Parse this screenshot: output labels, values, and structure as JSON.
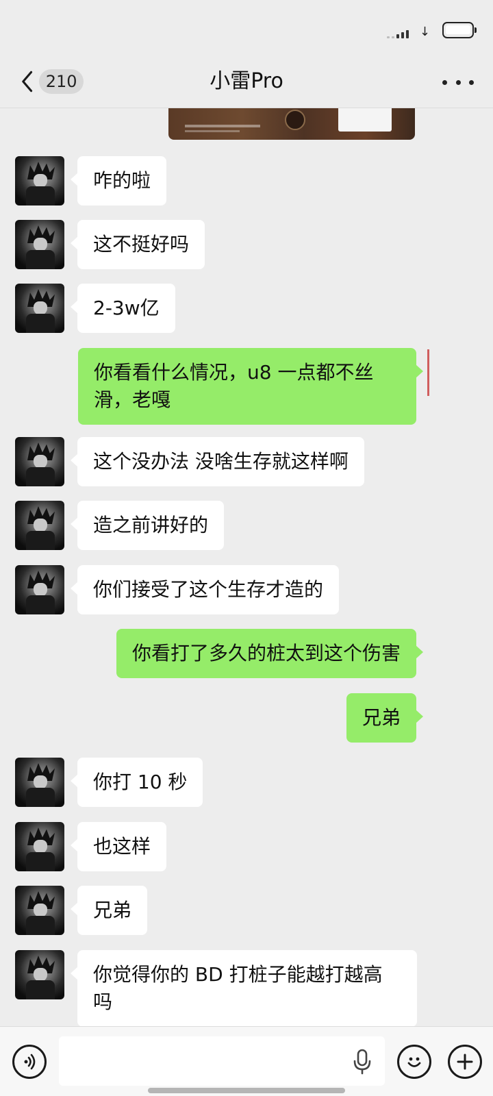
{
  "header": {
    "back_icon": "chevron-left-icon",
    "unread_count": "210",
    "title": "小雷Pro",
    "more_icon": "more-dots-icon"
  },
  "messages": [
    {
      "side": "in",
      "text": "咋的啦"
    },
    {
      "side": "in",
      "text": "这不挺好吗"
    },
    {
      "side": "in",
      "text": "2-3w亿"
    },
    {
      "side": "out",
      "text": "你看看什么情况，u8 一点都不丝滑，老嘎"
    },
    {
      "side": "in",
      "text": "这个没办法 没啥生存就这样啊"
    },
    {
      "side": "in",
      "text": "造之前讲好的"
    },
    {
      "side": "in",
      "text": "你们接受了这个生存才造的"
    },
    {
      "side": "out",
      "text": "你看打了多久的桩太到这个伤害"
    },
    {
      "side": "out",
      "text": "兄弟"
    },
    {
      "side": "in",
      "text": "你打 10 秒"
    },
    {
      "side": "in",
      "text": "也这样"
    },
    {
      "side": "in",
      "text": "兄弟"
    },
    {
      "side": "in",
      "text": "你觉得你的 BD 打桩子能越打越高吗"
    }
  ],
  "input_bar": {
    "voice_icon": "voice-mode-icon",
    "input_value": "",
    "mic_icon": "microphone-icon",
    "emoji_icon": "emoji-icon",
    "plus_icon": "plus-icon"
  },
  "colors": {
    "background": "#ededed",
    "incoming_bubble": "#ffffff",
    "outgoing_bubble": "#95ec69"
  }
}
